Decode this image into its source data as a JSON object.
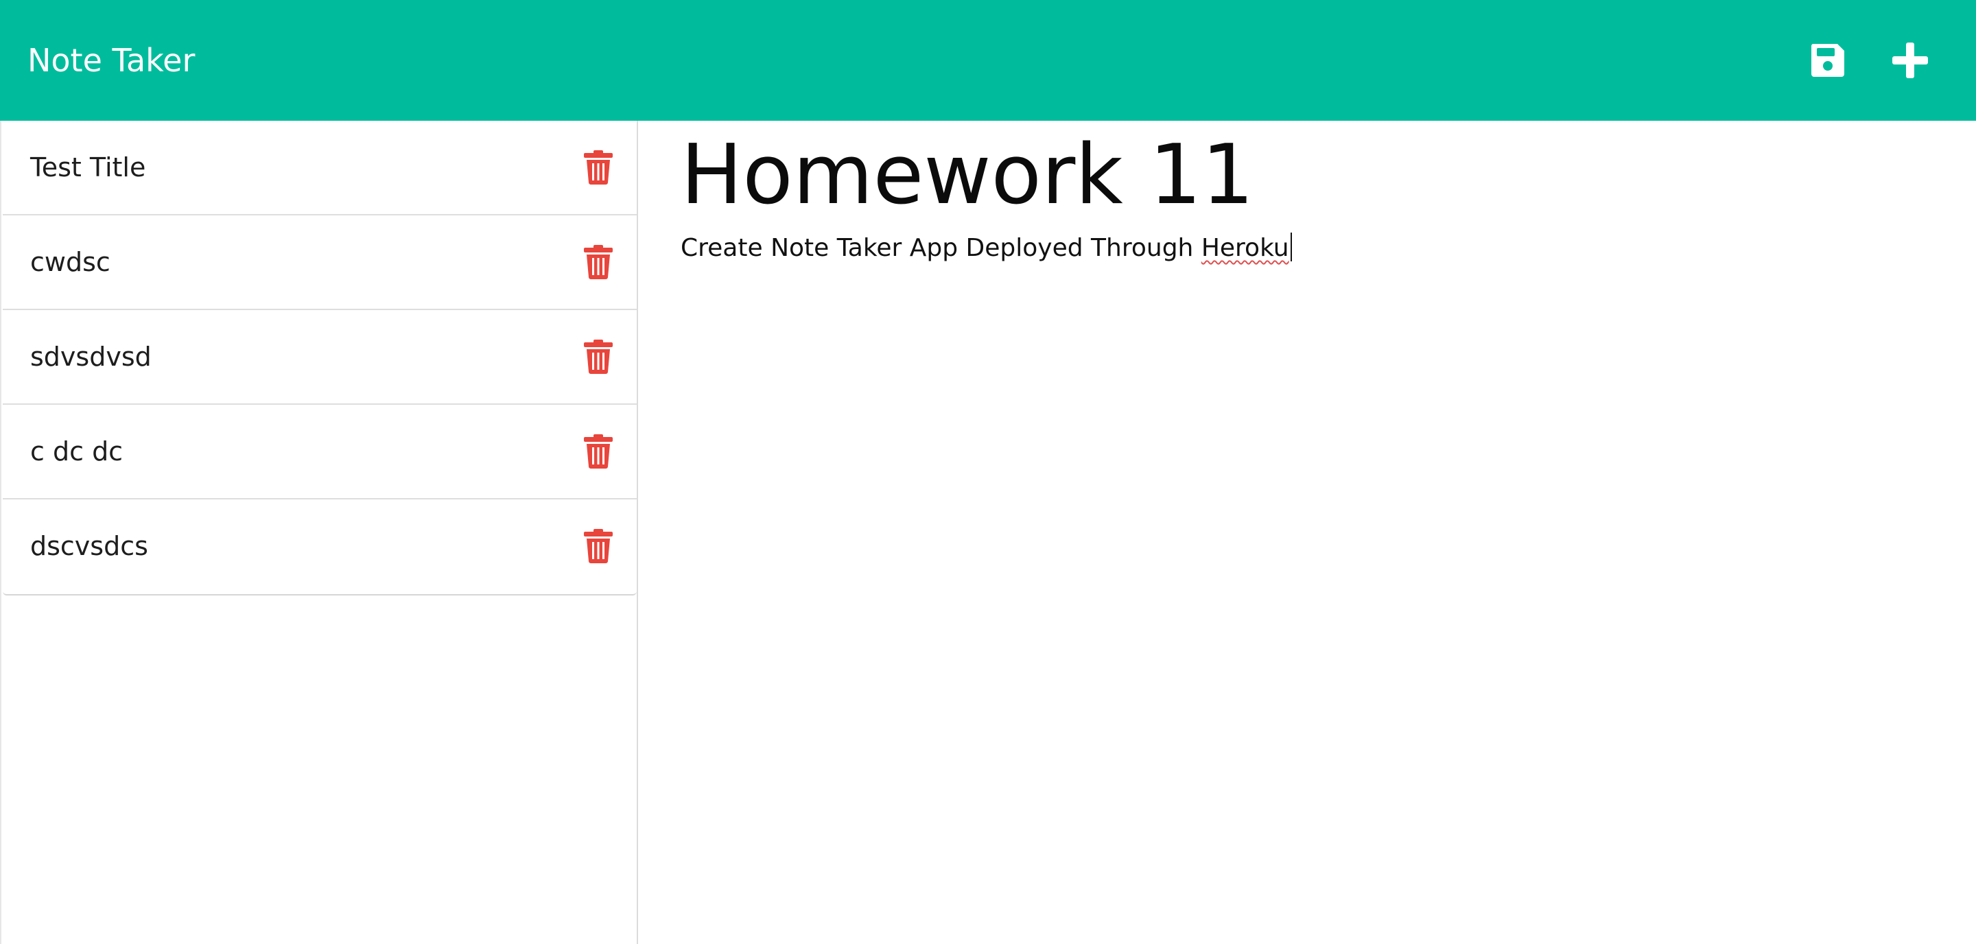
{
  "app": {
    "title": "Note Taker"
  },
  "toolbar": {
    "save_icon": "floppy-disk-icon",
    "new_icon": "plus-icon"
  },
  "notes": [
    {
      "title": "Test Title"
    },
    {
      "title": "cwdsc"
    },
    {
      "title": "sdvsdvsd"
    },
    {
      "title": "c dc dc"
    },
    {
      "title": "dscvsdcs"
    }
  ],
  "editor": {
    "title_value": "Homework 11",
    "body_prefix": "Create Note Taker App Deployed Through ",
    "body_misspelled": "Heroku"
  },
  "colors": {
    "navbar": "#00bc9c",
    "delete_icon": "#e8453c",
    "nav_icons": "#ffffff"
  }
}
